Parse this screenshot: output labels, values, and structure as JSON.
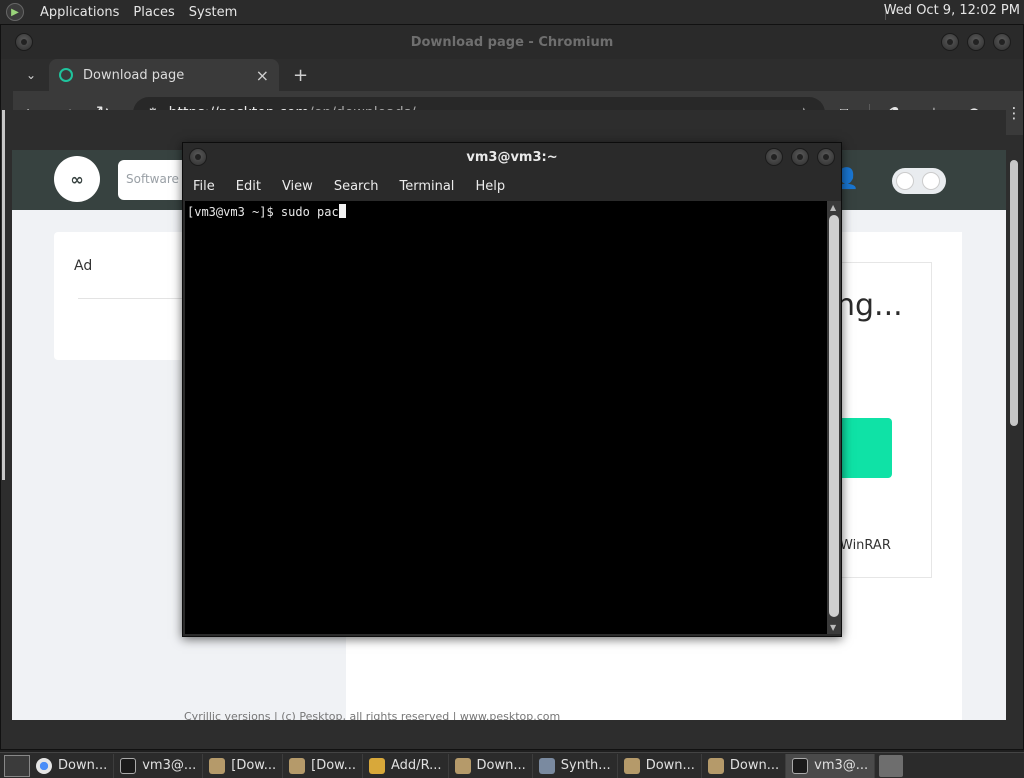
{
  "top_panel": {
    "menus": [
      "Applications",
      "Places",
      "System"
    ],
    "clock": "Wed Oct  9, 12:02 PM"
  },
  "chrome": {
    "window_title": "Download page - Chromium",
    "tab": {
      "title": "Download page",
      "close": "×"
    },
    "new_tab": "+",
    "url_host": "https://pesktop.com",
    "url_rest": "/en/downloads/"
  },
  "page": {
    "search_placeholder": "Software",
    "logo_text": "∞",
    "ad_label": "Ad",
    "loading_text": "ng...",
    "winrar_text": "WinRAR",
    "footer_text": "Cyrillic versions | (c) Pesktop, all rights reserved | www.pesktop.com"
  },
  "terminal": {
    "title": "vm3@vm3:~",
    "menu": [
      "File",
      "Edit",
      "View",
      "Search",
      "Terminal",
      "Help"
    ],
    "prompt": "[vm3@vm3 ~]$ ",
    "command": "sudo pac"
  },
  "taskbar": {
    "items": [
      {
        "label": "Down...",
        "icon": "chromium-icon"
      },
      {
        "label": "vm3@...",
        "icon": "terminal-icon"
      },
      {
        "label": "[Dow...",
        "icon": "folder-icon"
      },
      {
        "label": "[Dow...",
        "icon": "folder-icon"
      },
      {
        "label": "Add/R...",
        "icon": "archive-icon"
      },
      {
        "label": "Down...",
        "icon": "folder-icon"
      },
      {
        "label": "Synth...",
        "icon": "synth-icon"
      },
      {
        "label": "Down...",
        "icon": "folder-icon"
      },
      {
        "label": "Down...",
        "icon": "folder-icon"
      },
      {
        "label": "vm3@...",
        "icon": "terminal-icon"
      }
    ]
  }
}
